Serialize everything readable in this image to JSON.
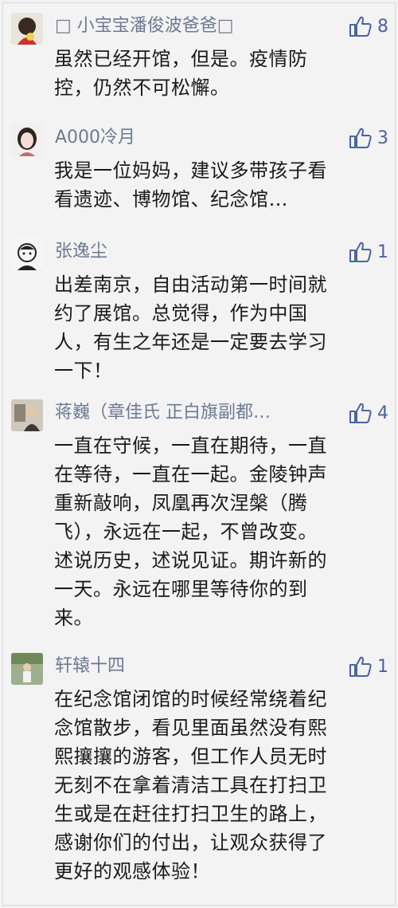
{
  "comments": [
    {
      "username": "□ 小宝宝潘俊波爸爸□",
      "likes": "8",
      "text_lines": [
        "虽然已经开馆，但是。疫情防",
        "控，仍然不可松懈。"
      ]
    },
    {
      "username": "A000冷月",
      "likes": "3",
      "text_lines": [
        "我是一位妈妈，建议多带孩子看",
        "看遗迹、博物馆、纪念馆…"
      ]
    },
    {
      "username": "张逸尘",
      "likes": "1",
      "text_lines": [
        "出差南京，自由活动第一时间就",
        "约了展馆。总觉得，作为中国",
        "人，有生之年还是一定要去学习",
        "一下！"
      ]
    },
    {
      "username": "蒋巍（章佳氏 正白旗副都…",
      "likes": "4",
      "text_lines": [
        "一直在守候，一直在期待，一直",
        "在等待，一直在一起。金陵钟声",
        "重新敲响，凤凰再次涅槃（腾",
        "飞），永远在一起，不曾改变。",
        "述说历史，述说见证。期许新的",
        "一天。永远在哪里等待你的到",
        "来。"
      ]
    },
    {
      "username": "轩辕十四",
      "likes": "1",
      "text_lines": [
        "在纪念馆闭馆的时候经常绕着纪",
        "念馆散步，看见里面虽然没有熙",
        "熙攘攘的游客，但工作人员无时",
        "无刻不在拿着清洁工具在打扫卫",
        "生或是在赶往打扫卫生的路上，",
        "感谢你们的付出，让观众获得了",
        "更好的观感体验！"
      ]
    }
  ]
}
